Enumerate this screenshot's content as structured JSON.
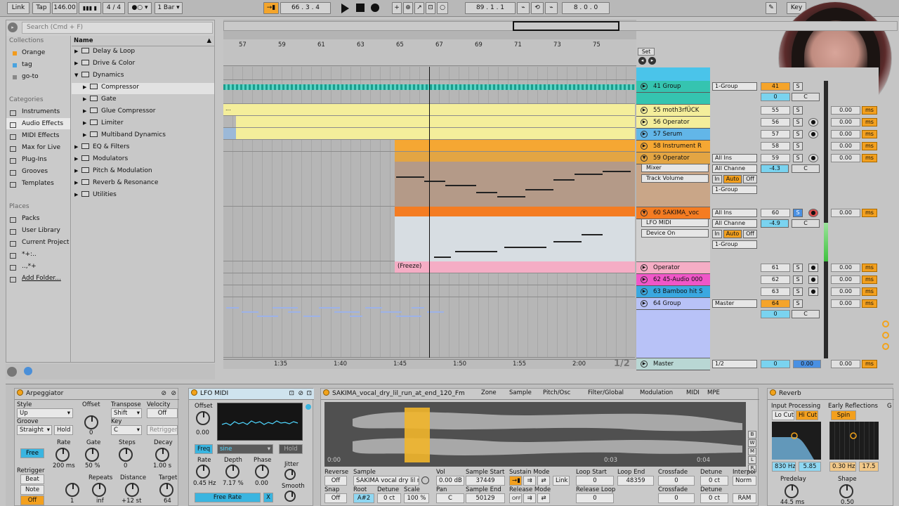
{
  "transport": {
    "link": "Link",
    "tap": "Tap",
    "tempo": "146.00",
    "time_sig": "4 / 4",
    "quant": "1 Bar",
    "position": "66 .   3 .   4",
    "loop_start": "89 .   1 .   1",
    "loop_len": "8 .   0 .   0",
    "key": "Key"
  },
  "browser": {
    "search_placeholder": "Search (Cmd + F)",
    "collections_title": "Collections",
    "collections": [
      "Orange",
      "tag",
      "go-to"
    ],
    "collection_colors": [
      "#f29b1d",
      "#4aa3df",
      "#888888"
    ],
    "categories_title": "Categories",
    "categories": [
      "Instruments",
      "Audio Effects",
      "MIDI Effects",
      "Max for Live",
      "Plug-Ins",
      "Grooves",
      "Templates"
    ],
    "places_title": "Places",
    "places": [
      "Packs",
      "User Library",
      "Current Project",
      "*+:..",
      "..,*+",
      "Add Folder..."
    ],
    "name_header": "Name",
    "tree": [
      {
        "label": "Delay & Loop",
        "open": false,
        "indent": 0
      },
      {
        "label": "Drive & Color",
        "open": false,
        "indent": 0
      },
      {
        "label": "Dynamics",
        "open": true,
        "indent": 0
      },
      {
        "label": "Compressor",
        "open": false,
        "indent": 1,
        "selected": true
      },
      {
        "label": "Gate",
        "open": false,
        "indent": 1
      },
      {
        "label": "Glue Compressor",
        "open": false,
        "indent": 1
      },
      {
        "label": "Limiter",
        "open": false,
        "indent": 1
      },
      {
        "label": "Multiband Dynamics",
        "open": false,
        "indent": 1
      },
      {
        "label": "EQ & Filters",
        "open": false,
        "indent": 0
      },
      {
        "label": "Modulators",
        "open": false,
        "indent": 0
      },
      {
        "label": "Pitch & Modulation",
        "open": false,
        "indent": 0
      },
      {
        "label": "Reverb & Resonance",
        "open": false,
        "indent": 0
      },
      {
        "label": "Utilities",
        "open": false,
        "indent": 0
      }
    ]
  },
  "arrangement": {
    "bars": [
      "57",
      "59",
      "61",
      "63",
      "65",
      "67",
      "69",
      "71",
      "73",
      "75"
    ],
    "times": [
      "1:35",
      "1:40",
      "1:45",
      "1:50",
      "1:55",
      "2:00"
    ],
    "page": "1/2",
    "set_label": "Set",
    "freeze_label": "(Freeze)",
    "ellipsis": "..."
  },
  "tracks": [
    {
      "name": "41 Group",
      "color": "#35c4b0",
      "num": "41",
      "route": "1-Group",
      "num_style": "orange",
      "vol": ""
    },
    {
      "name": "55 moth3rfÜCK",
      "color": "#f4ee9b",
      "num": "55",
      "vol": "0.00"
    },
    {
      "name": "56 Operator",
      "color": "#f4ee9b",
      "num": "56",
      "vol": "0.00"
    },
    {
      "name": "57 Serum",
      "color": "#62b6e8",
      "num": "57",
      "vol": "0.00"
    },
    {
      "name": "58 Instrument R",
      "color": "#f5a733",
      "num": "58",
      "vol": "0.00"
    },
    {
      "name": "59 Operator",
      "color": "#e3a543",
      "num": "59",
      "vol": "0.00"
    },
    {
      "name": "60 SAKIMA_voc",
      "color": "#f47c22",
      "num": "60",
      "vol": "0.00"
    },
    {
      "name": "Operator",
      "color": "#f5adc5",
      "num": "61",
      "vol": "0.00"
    },
    {
      "name": "62 45-Audio 000",
      "color": "#f056c8",
      "num": "62",
      "vol": "0.00"
    },
    {
      "name": "63 Bamboo hit S",
      "color": "#3aa8e0",
      "num": "63",
      "vol": "0.00"
    },
    {
      "name": "64 Group",
      "color": "#b8c2f7",
      "num": "64",
      "route": "Master",
      "vol": "0.00"
    },
    {
      "name": "Master",
      "color": "#b9d7d4",
      "route": "1/2",
      "vol": "0.00"
    }
  ],
  "io": {
    "all_ins": "All Ins",
    "all_chan": "All Channe",
    "mixer": "Mixer",
    "track_volume": "Track Volume",
    "lfo_midi": "LFO MIDI",
    "device_on": "Device On",
    "in": "In",
    "auto": "Auto",
    "off": "Off",
    "group1": "1-Group",
    "val_59": "-4.3",
    "val_60": "-4.9",
    "c": "C",
    "zero": "0",
    "s": "S",
    "ms": "ms",
    "master_blue": "0.00"
  },
  "arp": {
    "title": "Arpeggiator",
    "style_lbl": "Style",
    "style": "Up",
    "groove_lbl": "Groove",
    "groove": "Straight",
    "hold": "Hold",
    "offset_lbl": "Offset",
    "offset": "0",
    "transpose_lbl": "Transpose",
    "transpose": "Shift",
    "key_lbl": "Key",
    "key": "C",
    "velocity_lbl": "Velocity",
    "velocity": "Off",
    "retrigger_btn": "Retrigger",
    "free": "Free",
    "rate_lbl": "Rate",
    "rate": "200 ms",
    "gate_lbl": "Gate",
    "gate": "50 %",
    "steps_lbl": "Steps",
    "steps": "0",
    "decay_lbl": "Decay",
    "decay": "1.00 s",
    "retrigger_lbl": "Retrigger",
    "beat": "Beat",
    "note": "Note",
    "off": "Off",
    "repeats_lbl": "Repeats",
    "repeats": "inf",
    "distance_lbl": "Distance",
    "distance": "+12 st",
    "target_lbl": "Target",
    "target": "64",
    "one": "1"
  },
  "lfo": {
    "title": "LFO MIDI",
    "offset_lbl": "Offset",
    "offset": "0.00",
    "freq": "Freq",
    "shape": "sine",
    "hold": "Hold",
    "rate_lbl": "Rate",
    "rate": "0.45 Hz",
    "depth_lbl": "Depth",
    "depth": "7.17 %",
    "phase_lbl": "Phase",
    "phase": "0.00",
    "jitter_lbl": "Jitter",
    "smooth_lbl": "Smooth",
    "free_rate": "Free Rate",
    "x": "X"
  },
  "sampler": {
    "filename": "SAKIMA_vocal_dry_lil_run_at_end_120_Fm",
    "tabs": [
      "Zone",
      "Sample",
      "Pitch/Osc",
      "Filter/Global",
      "Modulation",
      "MIDI",
      "MPE"
    ],
    "time_start": "0:00",
    "time_a": "0:03",
    "time_b": "0:04",
    "reverse_lbl": "Reverse",
    "reverse": "Off",
    "sample_lbl": "Sample",
    "sample": "SAKIMA vocal dry lil r",
    "vol_lbl": "Vol",
    "vol": "0.00 dB",
    "sstart_lbl": "Sample Start",
    "sstart": "37449",
    "sustain_lbl": "Sustain Mode",
    "link": "Link",
    "lstart_lbl": "Loop Start",
    "lstart": "0",
    "lend_lbl": "Loop End",
    "lend": "48359",
    "xfade_lbl": "Crossfade",
    "xfade": "0",
    "detune_lbl": "Detune",
    "detune": "0 ct",
    "interp_lbl": "Interpol",
    "interp": "Norm",
    "snap_lbl": "Snap",
    "snap": "Off",
    "root_lbl": "Root",
    "root": "A#2",
    "detune2_lbl": "Detune",
    "detune2": "0 ct",
    "scale_lbl": "Scale",
    "scale": "100 %",
    "pan_lbl": "Pan",
    "pan": "C",
    "send_lbl": "Sample End",
    "send": "50129",
    "release_lbl": "Release Mode",
    "release_off": "OFF",
    "rloop_lbl": "Release Loop",
    "rloop": "0",
    "xfade2_lbl": "Crossfade",
    "xfade2": "0",
    "detune3_lbl": "Detune",
    "detune3": "0 ct",
    "ram": "RAM",
    "side_letters": [
      "B",
      "W",
      "M",
      "L",
      "R"
    ]
  },
  "reverb": {
    "title": "Reverb",
    "input_lbl": "Input Processing",
    "locut": "Lo Cut",
    "hicut": "Hi Cut",
    "early_lbl": "Early Reflections",
    "spin": "Spin",
    "freq": "830 Hz",
    "q": "5.85",
    "spin_rate": "0.30 Hz",
    "spin_amt": "17.5",
    "predelay_lbl": "Predelay",
    "predelay": "44.5 ms",
    "shape_lbl": "Shape",
    "shape": "0.50",
    "g": "G"
  }
}
